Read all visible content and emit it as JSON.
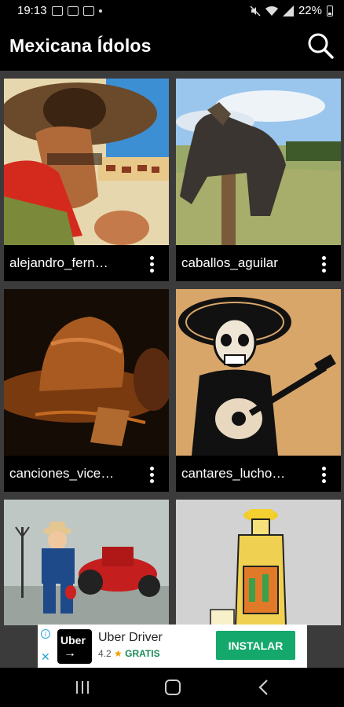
{
  "status_bar": {
    "time": "19:13",
    "battery": "22%"
  },
  "app_bar": {
    "title": "Mexicana Ídolos",
    "search_icon": "search-icon"
  },
  "grid": {
    "items": [
      {
        "label": "alejandro_fern…",
        "image": "cowboy-sombrero-illustration"
      },
      {
        "label": "caballos_aguilar",
        "image": "saddle-on-fence-post"
      },
      {
        "label": "canciones_vice…",
        "image": "cowboy-hat-dark"
      },
      {
        "label": "cantares_lucho…",
        "image": "mariachi-skeleton-guitar"
      },
      {
        "label": "",
        "image": "farmer-figurine-red-tractor"
      },
      {
        "label": "",
        "image": "tequila-bottle"
      }
    ]
  },
  "ad": {
    "logo_top": "Uber",
    "logo_arrow": "→",
    "app_name": "Uber Driver",
    "rating": "4.2",
    "price": "GRATIS",
    "install": "INSTALAR",
    "info": "i",
    "close": "✕"
  },
  "colors": {
    "background": "#3b3b3b",
    "install_button": "#15a86c"
  }
}
